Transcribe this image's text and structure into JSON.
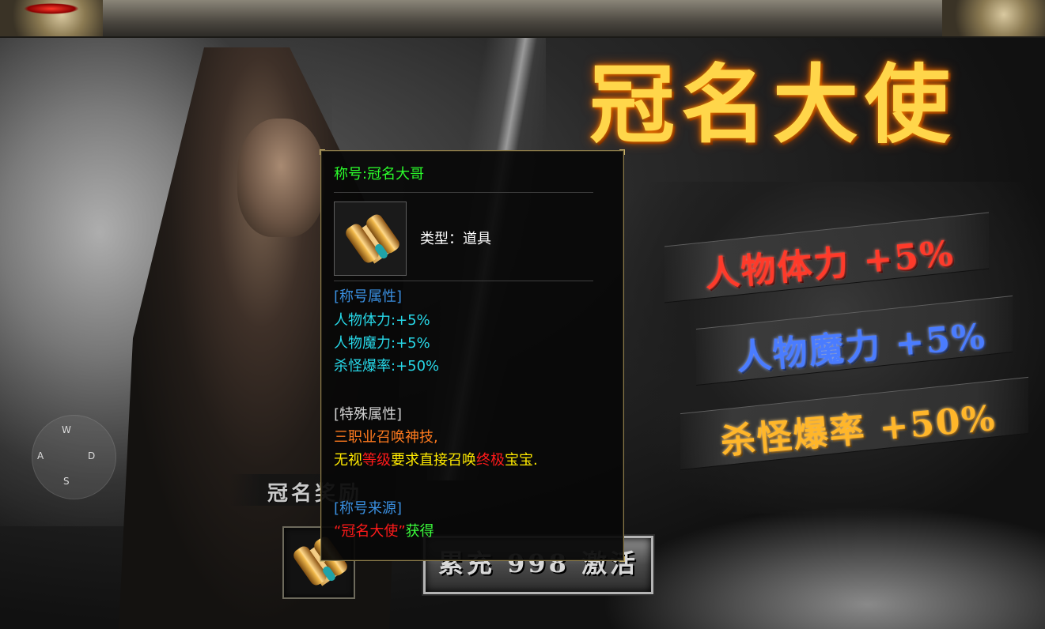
{
  "banner": {
    "title": "冠名大使",
    "stats": [
      {
        "text": "人物体力 +5%",
        "color": "#ff3a2a"
      },
      {
        "text": "人物魔力 +5%",
        "color": "#4a7cff"
      },
      {
        "text": "杀怪爆率 +50%",
        "color": "#ffb62a"
      }
    ],
    "reward_label": "冠名奖励",
    "activate_button": "累充 998 激活"
  },
  "joystick": {
    "up": "W",
    "left": "A",
    "right": "D",
    "down": "S"
  },
  "reward_item": {
    "icon": "scroll-icon"
  },
  "tooltip": {
    "title": "称号:冠名大哥",
    "type_label": "类型：道具",
    "icon": "scroll-icon",
    "section_attributes": "[称号属性]",
    "attributes": [
      "人物体力:+5%",
      "人物魔力:+5%",
      "杀怪爆率:+50%"
    ],
    "section_special": "[特殊属性]",
    "special_line1": "三职业召唤神技,",
    "special_line2_parts": [
      "无视",
      "等级",
      "要求直接召唤",
      "终极",
      "宝宝."
    ],
    "section_source": "[称号来源]",
    "source_parts": [
      "“冠名大使”",
      "获得"
    ]
  },
  "colors": {
    "title_green": "#2bff2b",
    "section_blue": "#3a8fe0",
    "attr_cyan": "#27d8e8",
    "special_orange": "#ff7a1e",
    "special_yellow": "#ffea00",
    "highlight_red": "#ff1a1a",
    "source_green": "#3cff3c"
  }
}
